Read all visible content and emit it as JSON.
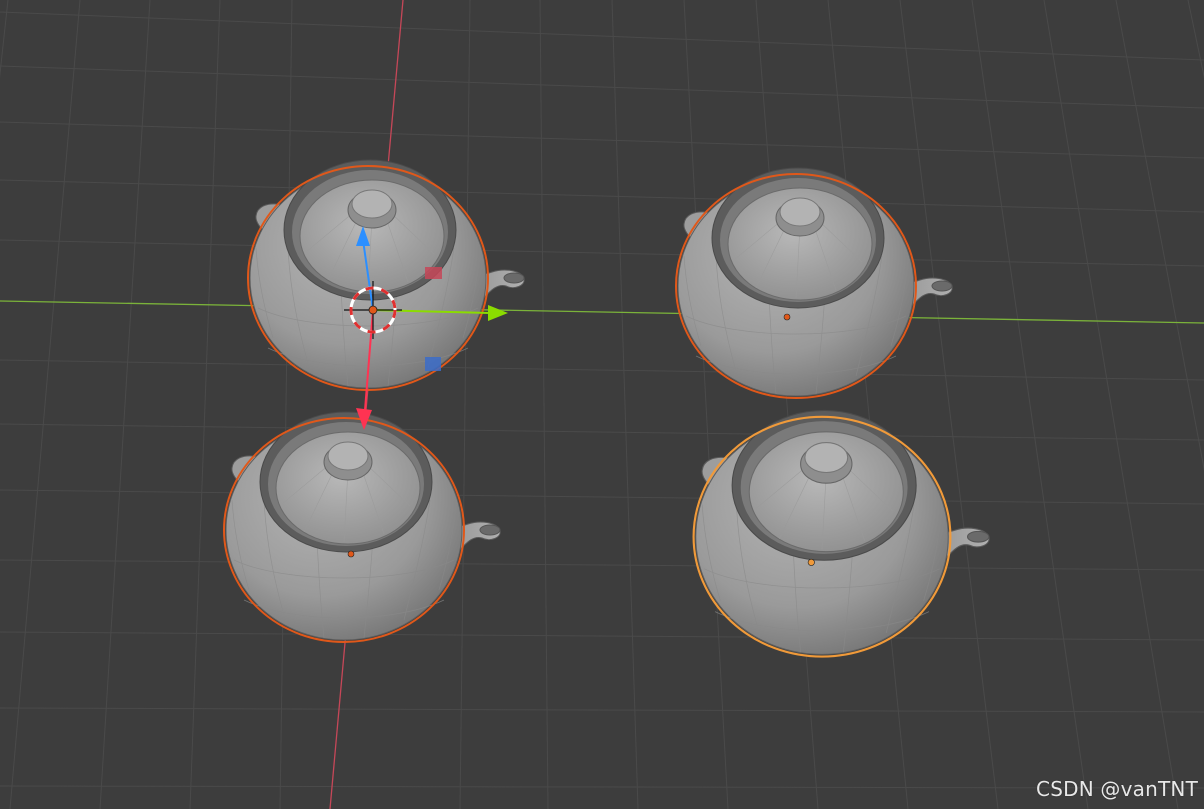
{
  "viewport": {
    "background": "#3d3d3d",
    "grid_color": "#4a4a4a",
    "x_axis_color": "#c64758",
    "y_axis_color": "#7bb33a"
  },
  "objects": [
    {
      "id": "teapot-top-left",
      "selection": "selected",
      "outline_color": "#e0581a"
    },
    {
      "id": "teapot-top-right",
      "selection": "selected",
      "outline_color": "#e0581a"
    },
    {
      "id": "teapot-bottom-left",
      "selection": "selected",
      "outline_color": "#e0581a"
    },
    {
      "id": "teapot-bottom-right",
      "selection": "active",
      "outline_color": "#f09a3a"
    }
  ],
  "gizmo": {
    "x_arrow_color": "#ff3352",
    "y_arrow_color": "#8bdc00",
    "z_arrow_color": "#2c8fff",
    "icons": [
      "3d-cursor-icon",
      "move-gizmo-icon"
    ]
  },
  "watermark": {
    "text": "CSDN @vanTNT"
  }
}
